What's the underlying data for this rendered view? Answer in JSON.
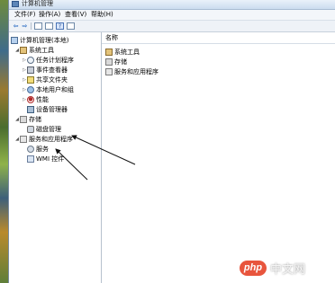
{
  "window": {
    "title": "计算机管理"
  },
  "menu": [
    {
      "label": "文件(F)"
    },
    {
      "label": "操作(A)"
    },
    {
      "label": "查看(V)"
    },
    {
      "label": "帮助(H)"
    }
  ],
  "toolbar": {
    "back_glyph": "⇦",
    "forward_glyph": "⇨",
    "help_glyph": "?"
  },
  "tree": {
    "root": "计算机管理(本地)",
    "system_tools": "系统工具",
    "task_scheduler": "任务计划程序",
    "event_viewer": "事件查看器",
    "shared_folders": "共享文件夹",
    "local_users": "本地用户和组",
    "performance": "性能",
    "device_manager": "设备管理器",
    "storage": "存储",
    "disk_management": "磁盘管理",
    "services_apps": "服务和应用程序",
    "services": "服务",
    "wmi": "WMI 控件"
  },
  "list": {
    "column_header": "名称",
    "items": [
      "系统工具",
      "存储",
      "服务和应用程序"
    ]
  },
  "watermark": {
    "logo": "php",
    "site": "中文网"
  },
  "colors": {
    "accent": "#2f6fc4",
    "watermark": "#e8553d"
  }
}
